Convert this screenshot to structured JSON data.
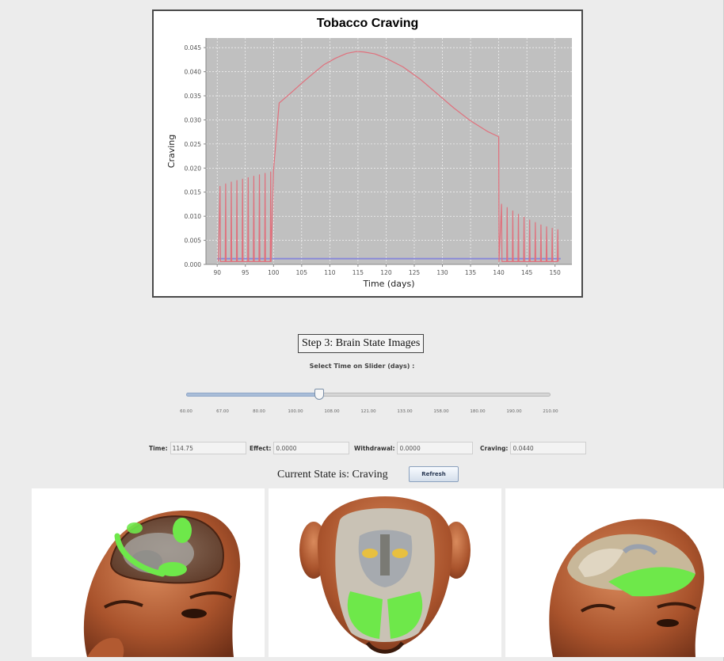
{
  "chart_data": {
    "type": "line",
    "title": "Tobacco Craving",
    "xlabel": "Time (days)",
    "ylabel": "Craving",
    "xlim": [
      88,
      153
    ],
    "ylim": [
      0,
      0.047
    ],
    "xticks": [
      90,
      95,
      100,
      105,
      110,
      115,
      120,
      125,
      130,
      135,
      140,
      145,
      150
    ],
    "yticks": [
      0.0,
      0.005,
      0.01,
      0.015,
      0.02,
      0.025,
      0.03,
      0.035,
      0.04,
      0.045
    ],
    "ytick_labels": [
      "0.000",
      "0.005",
      "0.010",
      "0.015",
      "0.020",
      "0.025",
      "0.030",
      "0.035",
      "0.040",
      "0.045"
    ],
    "grid": true,
    "background": "#c0c0c0",
    "series": [
      {
        "color": "#e0707c",
        "style": "spiky-line",
        "spike_days": [
          90.5,
          91.5,
          92.5,
          93.5,
          94.5,
          95.5,
          96.5,
          97.5,
          98.5,
          99.5
        ],
        "spike_peaks": [
          0.0162,
          0.0167,
          0.0171,
          0.0174,
          0.0177,
          0.018,
          0.0183,
          0.0186,
          0.0189,
          0.0192
        ],
        "x": [
          100,
          101,
          103,
          105,
          107,
          109,
          111,
          113,
          114.75,
          116,
          118,
          120,
          123,
          126,
          129,
          132,
          135,
          138,
          140
        ],
        "y": [
          0.0195,
          0.0335,
          0.0355,
          0.0376,
          0.0396,
          0.0415,
          0.0428,
          0.0438,
          0.0442,
          0.0441,
          0.0437,
          0.0428,
          0.041,
          0.0385,
          0.0355,
          0.0325,
          0.0298,
          0.0276,
          0.0265
        ],
        "spike_days_after": [
          140.5,
          141.5,
          142.5,
          143.5,
          144.5,
          145.5,
          146.5,
          147.5,
          148.5,
          149.5,
          150.5
        ],
        "spike_peaks_after": [
          0.0125,
          0.0118,
          0.0111,
          0.0104,
          0.0098,
          0.0092,
          0.0087,
          0.0082,
          0.0078,
          0.0075,
          0.0072
        ]
      },
      {
        "color": "#8a8ad8",
        "x": [
          90,
          151
        ],
        "y": [
          0.0012,
          0.0012
        ]
      }
    ]
  },
  "step3": {
    "title": "Step 3: Brain State Images",
    "slider_caption": "Select Time on Slider (days) :"
  },
  "slider": {
    "min": 60,
    "max": 210,
    "value": 114.75,
    "tick_labels": [
      "60.00",
      "67.00",
      "80.00",
      "100.00",
      "108.00",
      "121.00",
      "133.00",
      "158.00",
      "180.00",
      "190.00",
      "210.00"
    ]
  },
  "readouts": {
    "time_label": "Time:",
    "time_value": "114.75",
    "effect_label": "Effect:",
    "effect_value": "0.0000",
    "withdrawal_label": "Withdrawal:",
    "withdrawal_value": "0.0000",
    "craving_label": "Craving:",
    "craving_value": "0.0440"
  },
  "state": {
    "text": "Current State is: Craving",
    "refresh_label": "Refresh"
  },
  "colors": {
    "skin": "#b0582e",
    "active_region": "#6ee84a",
    "brain_gray": "#a8a8a4"
  }
}
